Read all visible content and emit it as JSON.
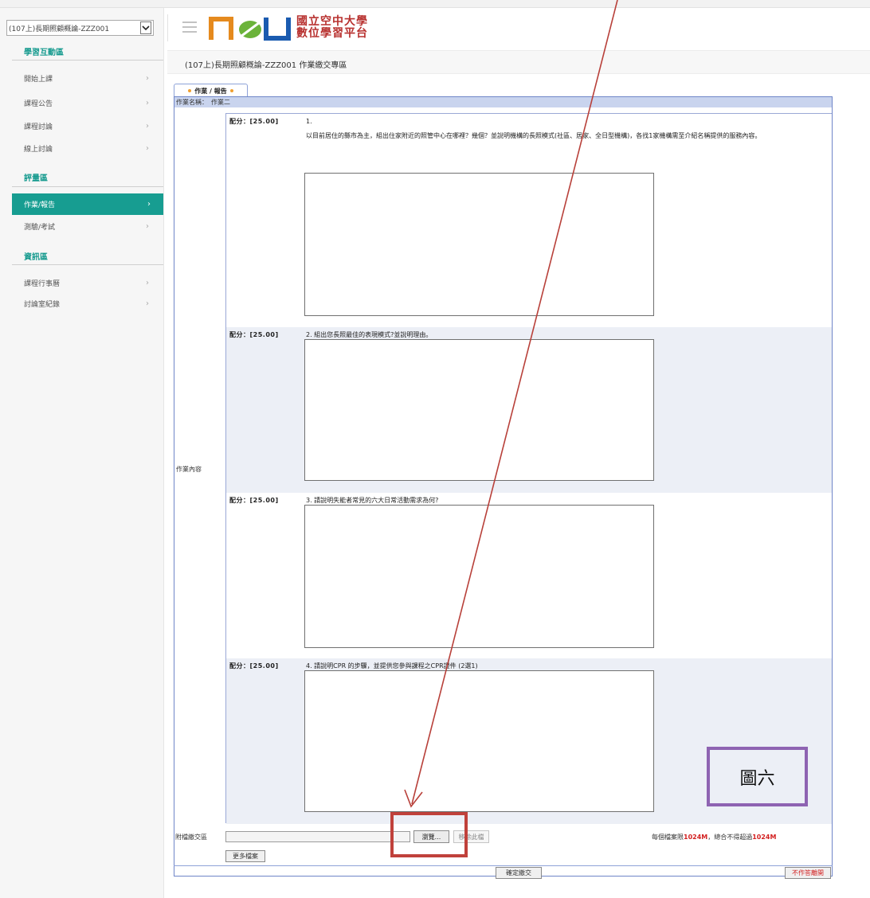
{
  "sidebar": {
    "course_select": "(107上)長期照顧概論-ZZZ001",
    "sections": [
      {
        "title": "學習互動區",
        "items": [
          "開始上課",
          "課程公告",
          "課程討論",
          "線上討論"
        ]
      },
      {
        "title": "評量區",
        "items": [
          "作業/報告",
          "測驗/考試"
        ]
      },
      {
        "title": "資訊區",
        "items": [
          "課程行事曆",
          "討論室紀錄"
        ]
      }
    ],
    "active_item": "作業/報告"
  },
  "header": {
    "logo_text": "NOU",
    "logo_cn_line1": "國立空中大學",
    "logo_cn_line2": "數位學習平台",
    "page_title": "(107上)長期照顧概論-ZZZ001 作業繳交專區"
  },
  "homework": {
    "tab_label": "作業 / 報告",
    "name_label": "作業名稱：",
    "name_value": "作業二",
    "content_label": "作業內容",
    "questions": [
      {
        "score": "配分：[25.00]",
        "text": "1.\n以目前居住的縣市為主，組出住家附近的照管中心在哪裡？幾個？並說明機構的長照模式(社區、居家、全日型機構)，各找1家機構需至介紹名稱提供的服務內容。"
      },
      {
        "score": "配分：[25.00]",
        "text": "2. 組出您長照最佳的表現模式?並說明理由。"
      },
      {
        "score": "配分：[25.00]",
        "text": "3. 請說明失能者常見的六大日常活動需求為何?"
      },
      {
        "score": "配分：[25.00]",
        "text": "4. 請說明CPR  的步驟，並提供您參與課程之CPR證件 (2選1)"
      }
    ]
  },
  "attachment": {
    "label": "附檔繳交區",
    "browse_label": "瀏覽...",
    "remove_label": "移除此檔",
    "limit_prefix": "每個檔案限",
    "limit_size_1": "1024M",
    "limit_middle": "，總合不得超過",
    "limit_size_2": "1024M",
    "more_label": "更多檔案"
  },
  "actions": {
    "submit_label": "確定繳交",
    "cancel_label": "不作答離開"
  },
  "annotation": {
    "figure_label": "圖六"
  },
  "colors": {
    "accent": "#179d91",
    "frame_border": "#6f85c8",
    "highlight": "#c0413b",
    "figure_box": "#8e63b2",
    "arrow": "#b8403a"
  }
}
